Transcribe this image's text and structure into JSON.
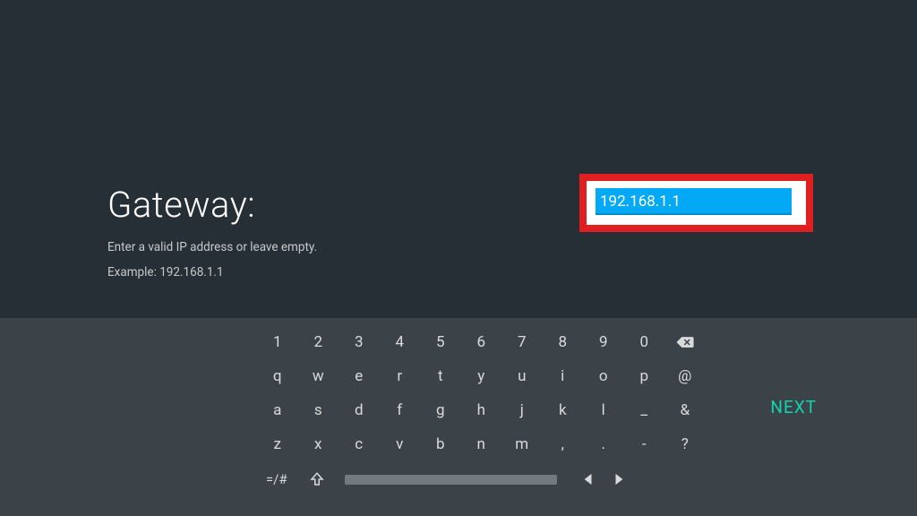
{
  "title": "Gateway:",
  "hint1": "Enter a valid IP address or leave empty.",
  "hint2": "Example: 192.168.1.1",
  "input_value": "192.168.1.1",
  "next_label": "NEXT",
  "keyboard": {
    "row1": [
      "1",
      "2",
      "3",
      "4",
      "5",
      "6",
      "7",
      "8",
      "9",
      "0"
    ],
    "row2": [
      "q",
      "w",
      "e",
      "r",
      "t",
      "y",
      "u",
      "i",
      "o",
      "p",
      "@"
    ],
    "row3": [
      "a",
      "s",
      "d",
      "f",
      "g",
      "h",
      "j",
      "k",
      "l",
      "_",
      "&"
    ],
    "row4": [
      "z",
      "x",
      "c",
      "v",
      "b",
      "n",
      "m",
      ",",
      ".",
      "-",
      "?"
    ],
    "sym_label": "=/#",
    "focused_key": "t"
  }
}
